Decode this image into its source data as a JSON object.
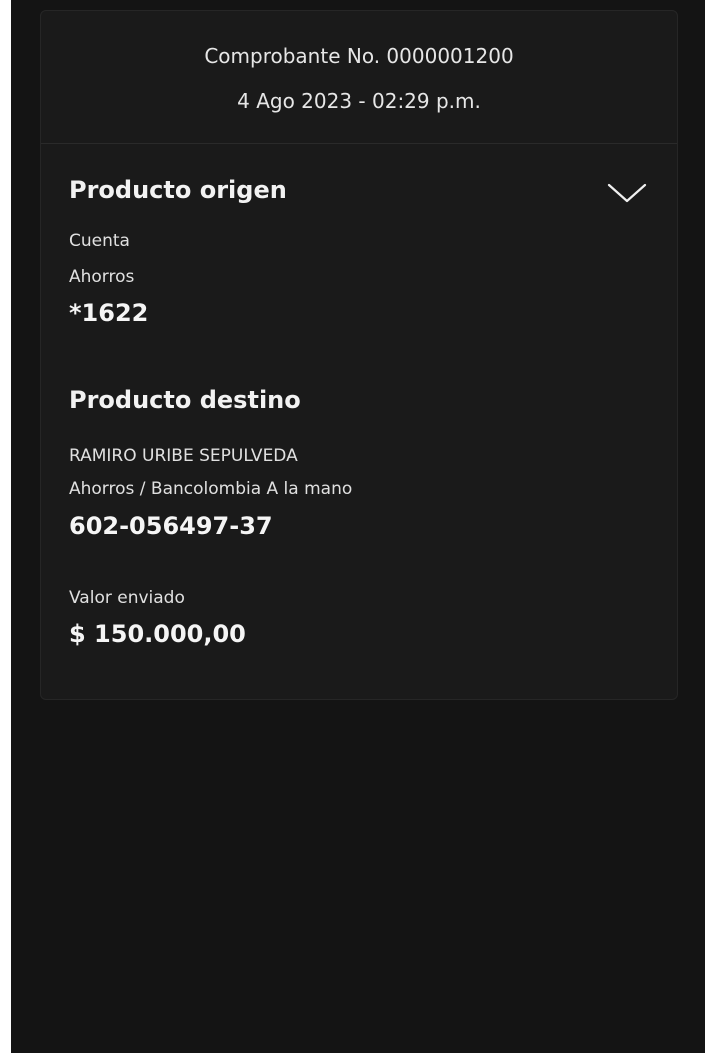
{
  "receipt": {
    "number_label": "Comprobante No. 0000001200",
    "datetime": "4 Ago 2023 - 02:29 p.m."
  },
  "origin": {
    "title": "Producto origen",
    "type_line1": "Cuenta",
    "type_line2": "Ahorros",
    "account": "*1622",
    "expand_icon": "chevron-down-icon"
  },
  "destination": {
    "title": "Producto destino",
    "name": "RAMIRO  URIBE SEPULVEDA",
    "type": "Ahorros / Bancolombia A la mano",
    "account": "602-056497-37"
  },
  "amount": {
    "label": "Valor enviado",
    "value": "$ 150.000,00"
  },
  "colors": {
    "background": "#141414",
    "card": "#1a1a1a",
    "text": "#f2f2f2"
  }
}
